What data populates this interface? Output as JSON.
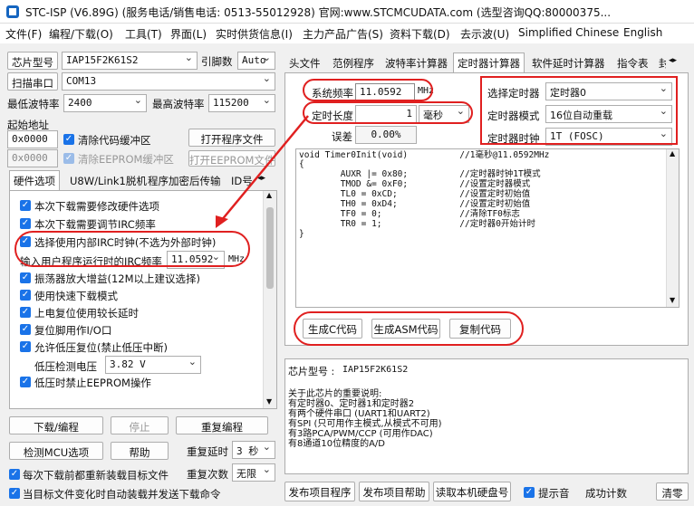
{
  "title": {
    "text": "STC-ISP (V6.89G) (服务电话/销售电话: 0513-55012928) 官网:www.STCMCUDATA.com  (选型咨询QQ:80000375..."
  },
  "menu": [
    "文件(F)",
    "编程/下载(O)",
    "工具(T)",
    "界面(L)",
    "实时供货信息(I)",
    "主力产品广告(S)",
    "资料下载(D)",
    "去示波(U)",
    "Simplified Chinese",
    "English"
  ],
  "left": {
    "chip_label": "芯片型号",
    "chip_value": "IAP15F2K61S2",
    "pin_label": "引脚数",
    "pin_value": "Auto",
    "scan_btn": "扫描串口",
    "port_value": "COM13",
    "min_baud_label": "最低波特率",
    "min_baud_value": "2400",
    "max_baud_label": "最高波特率",
    "max_baud_value": "115200",
    "start_addr_label": "起始地址",
    "addr1": "0x0000",
    "clear_code_label": "清除代码缓冲区",
    "open_prog_btn": "打开程序文件",
    "addr2": "0x0000",
    "clear_eeprom_label": "清除EEPROM缓冲区",
    "open_eeprom_btn": "打开EEPROM文件",
    "tabs": [
      "硬件选项",
      "U8W/Link1脱机",
      "程序加密后传输",
      "ID号"
    ],
    "options": [
      "本次下载需要修改硬件选项",
      "本次下载需要调节IRC频率",
      "选择使用内部IRC时钟(不选为外部时钟)"
    ],
    "irc_label": "输入用户程序运行时的IRC频率",
    "irc_value": "11.0592",
    "irc_unit": "MHz",
    "options2": [
      "振荡器放大增益(12M以上建议选择)",
      "使用快速下载模式",
      "上电复位使用较长延时",
      "复位脚用作I/O口",
      "允许低压复位(禁止低压中断)"
    ],
    "lvd_label": "低压检测电压",
    "lvd_value": "3.82 V",
    "option_last": "低压时禁止EEPROM操作",
    "download_btn": "下载/编程",
    "stop_btn": "停止",
    "reprog_btn": "重复编程",
    "detect_btn": "检测MCU选项",
    "help_btn": "帮助",
    "retry_delay_label": "重复延时",
    "retry_delay_value": "3 秒",
    "retry_count_label": "重复次数",
    "retry_count_value": "无限",
    "reload_label": "每次下载前都重新装载目标文件",
    "autoload_label": "当目标文件变化时自动装载并发送下载命令"
  },
  "right": {
    "tabs": [
      "头文件",
      "范例程序",
      "波特率计算器",
      "定时器计算器",
      "软件延时计算器",
      "指令表",
      "封"
    ],
    "sys_freq_label": "系统频率",
    "sys_freq_value": "11.0592",
    "sys_freq_unit": "MHz",
    "timer_len_label": "定时长度",
    "timer_len_value": "1",
    "timer_len_unit": "毫秒",
    "error_label": "误差",
    "error_value": "0.00%",
    "sel_timer_label": "选择定时器",
    "sel_timer_value": "定时器0",
    "timer_mode_label": "定时器模式",
    "timer_mode_value": "16位自动重载",
    "timer_clock_label": "定时器时钟",
    "timer_clock_value": "1T (FOSC)",
    "code_lines": [
      "void Timer0Init(void)          //1毫秒@11.0592MHz",
      "{",
      "        AUXR |= 0x80;          //定时器时钟1T模式",
      "        TMOD &= 0xF0;          //设置定时器模式",
      "        TL0 = 0xCD;            //设置定时初始值",
      "        TH0 = 0xD4;            //设置定时初始值",
      "        TF0 = 0;               //清除TF0标志",
      "        TR0 = 1;               //定时器0开始计时",
      "}"
    ],
    "gen_c_btn": "生成C代码",
    "gen_asm_btn": "生成ASM代码",
    "copy_btn": "复制代码",
    "chip_info_label": "芯片型号 :",
    "chip_info_value": "IAP15F2K61S2",
    "notes": [
      "关于此芯片的重要说明:",
      "  有定时器0、定时器1和定时器2",
      "  有两个硬件串口 (UART1和UART2)",
      "  有SPI (只可用作主模式,从模式不可用)",
      "  有3路PCA/PWM/CCP (可用作DAC)",
      "  有8通道10位精度的A/D"
    ],
    "publish_btn": "发布项目程序",
    "publish_help_btn": "发布项目帮助",
    "read_disk_btn": "读取本机硬盘号",
    "beep_label": "提示音",
    "success_count_label": "成功计数",
    "clear_btn": "清零"
  },
  "colors": {
    "annotation": "#e02020",
    "checkbox": "#1a73e8"
  }
}
